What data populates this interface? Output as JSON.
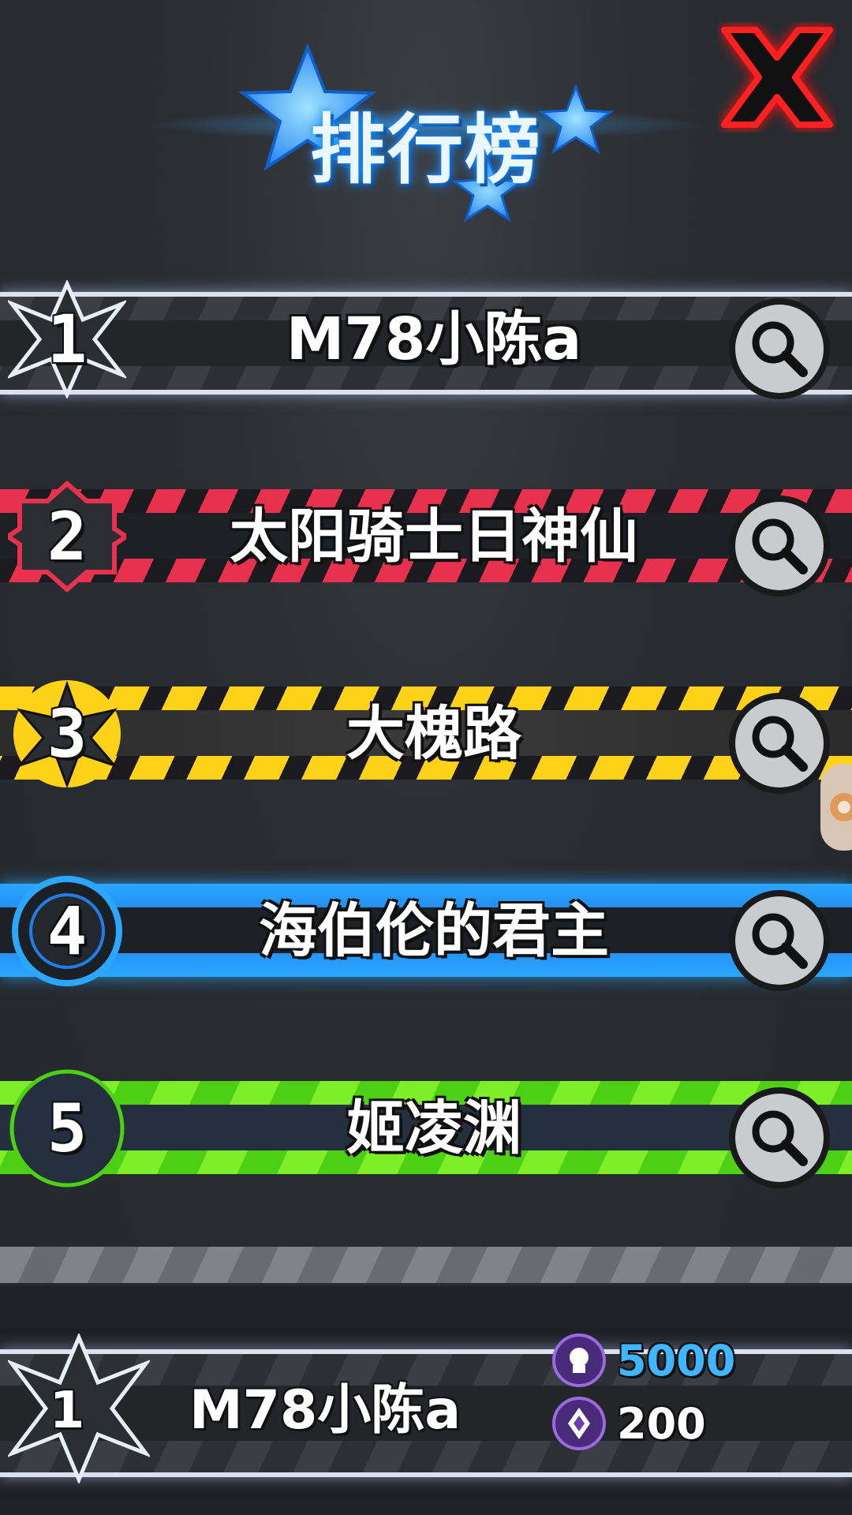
{
  "header": {
    "title": "排行榜",
    "close_icon": "close-x-icon",
    "accent": "#1e8fff"
  },
  "ranking": [
    {
      "rank": "1",
      "name": "M78小陈a",
      "theme": "silver",
      "search_icon": "magnifier-icon"
    },
    {
      "rank": "2",
      "name": "太阳骑士日神仙",
      "theme": "red",
      "search_icon": "magnifier-icon"
    },
    {
      "rank": "3",
      "name": "大槐路",
      "theme": "yellow",
      "search_icon": "magnifier-icon"
    },
    {
      "rank": "4",
      "name": "海伯伦的君主",
      "theme": "blue",
      "search_icon": "magnifier-icon"
    },
    {
      "rank": "5",
      "name": "姬凌渊",
      "theme": "green",
      "search_icon": "magnifier-icon"
    }
  ],
  "my_rank": {
    "rank": "1",
    "name": "M78小陈a",
    "currency_primary": {
      "icon": "purple-token-icon",
      "amount": "5000",
      "color": "#3fb6ff"
    },
    "currency_secondary": {
      "icon": "purple-gem-coin-icon",
      "amount": "200",
      "color": "#ffffff"
    }
  }
}
